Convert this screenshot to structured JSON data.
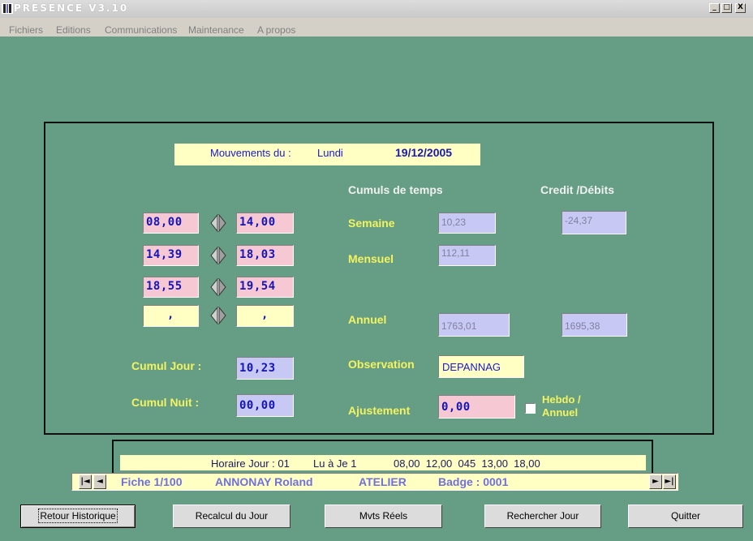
{
  "window": {
    "title": "PRESENCE  V3.10",
    "minimize": "_",
    "maximize": "□",
    "close": "X"
  },
  "menu": [
    "Fichiers",
    "Editions",
    "Communications",
    "Maintenance",
    "A propos"
  ],
  "header": {
    "label": "Mouvements du :",
    "day": "Lundi",
    "date": "19/12/2005"
  },
  "columns": {
    "cumuls": "Cumuls de temps",
    "credit": "Credit /Débits"
  },
  "movements": [
    {
      "in": "08,00",
      "out": "14,00"
    },
    {
      "in": "14,39",
      "out": "18,03"
    },
    {
      "in": "18,55",
      "out": "19,54"
    },
    {
      "in": ",",
      "out": ","
    }
  ],
  "cumuls": {
    "semaine_label": "Semaine",
    "semaine_value": "10,23",
    "semaine_credit": "-24,37",
    "mensuel_label": "Mensuel",
    "mensuel_value": "112,11",
    "annuel_label": "Annuel",
    "annuel_value": "1763,01",
    "annuel_credit": "1695,38"
  },
  "day_totals": {
    "cumul_jour_label": "Cumul Jour :",
    "cumul_jour_value": "10,23",
    "cumul_nuit_label": "Cumul Nuit :",
    "cumul_nuit_value": "00,00"
  },
  "observation": {
    "label": "Observation",
    "value": "DEPANNAG"
  },
  "ajustement": {
    "label": "Ajustement",
    "value": "0,00",
    "hebdo_label_1": "Hebdo /",
    "hebdo_label_2": "Annuel",
    "checked": false
  },
  "horaire": {
    "label": "Horaire Jour : 01",
    "days": "Lu à Je 1",
    "times": "08,00  12,00  045  13,00  18,00"
  },
  "record": {
    "fiche": "Fiche 1/100",
    "name": "ANNONAY Roland",
    "service": "ATELIER",
    "badge": "Badge : 0001"
  },
  "buttons": {
    "retour": "Retour Historique",
    "recalcul": "Recalcul du Jour",
    "mvts": "Mvts Réels",
    "rechercher": "Rechercher Jour",
    "quitter": "Quitter"
  },
  "colors": {
    "background": "#669e85",
    "label_yellow": "#f3f360",
    "value_blue": "#1414b8"
  }
}
